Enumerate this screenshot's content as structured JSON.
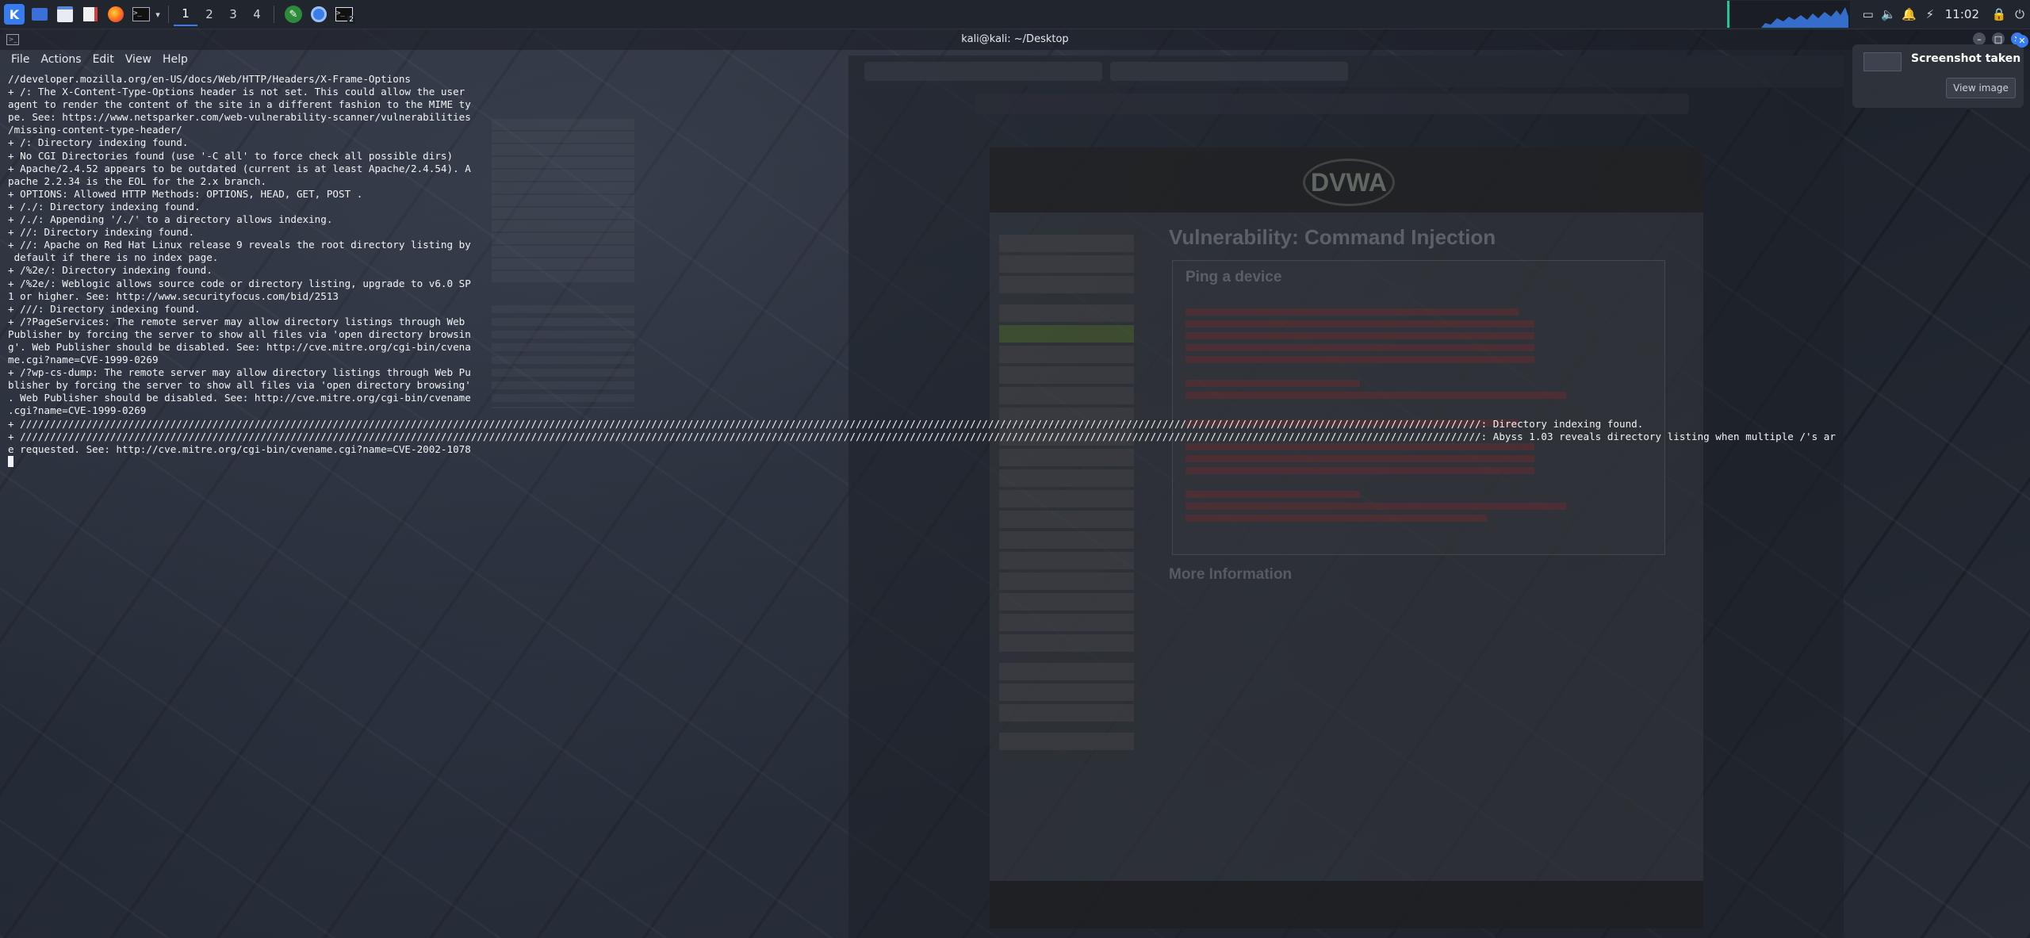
{
  "panel": {
    "workspaces": [
      "1",
      "2",
      "3",
      "4"
    ],
    "active_workspace": "1",
    "terminal_badge": "2",
    "clock": "11:02"
  },
  "terminal": {
    "title": "kali@kali: ~/Desktop",
    "menu": [
      "File",
      "Actions",
      "Edit",
      "View",
      "Help"
    ],
    "lines": [
      "//developer.mozilla.org/en-US/docs/Web/HTTP/Headers/X-Frame-Options",
      "+ /: The X-Content-Type-Options header is not set. This could allow the user",
      "agent to render the content of the site in a different fashion to the MIME ty",
      "pe. See: https://www.netsparker.com/web-vulnerability-scanner/vulnerabilities",
      "/missing-content-type-header/",
      "+ /: Directory indexing found.",
      "+ No CGI Directories found (use '-C all' to force check all possible dirs)",
      "+ Apache/2.4.52 appears to be outdated (current is at least Apache/2.4.54). A",
      "pache 2.2.34 is the EOL for the 2.x branch.",
      "+ OPTIONS: Allowed HTTP Methods: OPTIONS, HEAD, GET, POST .",
      "+ /./: Directory indexing found.",
      "+ /./: Appending '/./' to a directory allows indexing.",
      "+ //: Directory indexing found.",
      "+ //: Apache on Red Hat Linux release 9 reveals the root directory listing by",
      " default if there is no index page.",
      "+ /%2e/: Directory indexing found.",
      "+ /%2e/: Weblogic allows source code or directory listing, upgrade to v6.0 SP",
      "1 or higher. See: http://www.securityfocus.com/bid/2513",
      "+ ///: Directory indexing found.",
      "+ /?PageServices: The remote server may allow directory listings through Web",
      "Publisher by forcing the server to show all files via 'open directory browsin",
      "g'. Web Publisher should be disabled. See: http://cve.mitre.org/cgi-bin/cvena",
      "me.cgi?name=CVE-1999-0269",
      "+ /?wp-cs-dump: The remote server may allow directory listings through Web Pu",
      "blisher by forcing the server to show all files via 'open directory browsing'",
      ". Web Publisher should be disabled. See: http://cve.mitre.org/cgi-bin/cvename",
      ".cgi?name=CVE-1999-0269",
      "+ ///////////////////////////////////////////////////////////////////////////////////////////////////////////////////////////////////////////////////////////////////////////////////////////////////////////////////////////////////////////////////: Directory indexing found.",
      "+ ///////////////////////////////////////////////////////////////////////////////////////////////////////////////////////////////////////////////////////////////////////////////////////////////////////////////////////////////////////////////////: Abyss 1.03 reveals directory listing when multiple /'s ar",
      "e requested. See: http://cve.mitre.org/cgi-bin/cvename.cgi?name=CVE-2002-1078"
    ]
  },
  "notification": {
    "title": "Screenshot taken",
    "button": "View image"
  },
  "background": {
    "dvwa_logo": "DVWA",
    "dvwa_heading": "Vulnerability: Command Injection",
    "dvwa_box_title": "Ping a device",
    "dvwa_more": "More Information"
  }
}
